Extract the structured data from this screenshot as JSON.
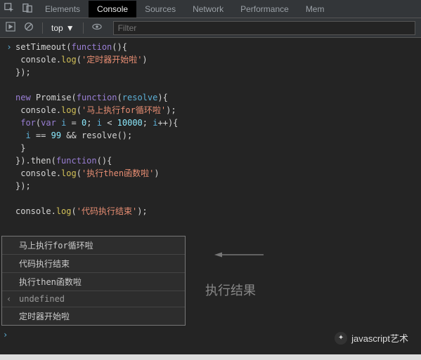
{
  "tabs": {
    "items": [
      "Elements",
      "Console",
      "Sources",
      "Network",
      "Performance",
      "Mem"
    ],
    "activeIndex": 1
  },
  "toolbar": {
    "context": "top",
    "filterPlaceholder": "Filter"
  },
  "code": {
    "l1a": "setTimeout",
    "l1b": "function",
    "l2a": "console",
    "l2b": "log",
    "l2c": "'定时器开始啦'",
    "l3": "});",
    "l5a": "new",
    "l5b": "Promise",
    "l5c": "function",
    "l5d": "resolve",
    "l6a": "console",
    "l6b": "log",
    "l6c": "'马上执行for循环啦'",
    "l7a": "for",
    "l7b": "var",
    "l7c": "i",
    "l7d": "0",
    "l7e": "i",
    "l7f": "10000",
    "l7g": "i",
    "l8a": "i",
    "l8b": "99",
    "l8c": "resolve",
    "l9": " }",
    "l10a": "then",
    "l10b": "function",
    "l11a": "console",
    "l11b": "log",
    "l11c": "'执行then函数啦'",
    "l12": "});",
    "l14a": "console",
    "l14b": "log",
    "l14c": "'代码执行结束'"
  },
  "output": [
    "马上执行for循环啦",
    "代码执行结束",
    "执行then函数啦",
    "undefined",
    "定时器开始啦"
  ],
  "resultLabel": "执行结果",
  "watermark": "javascript艺术"
}
